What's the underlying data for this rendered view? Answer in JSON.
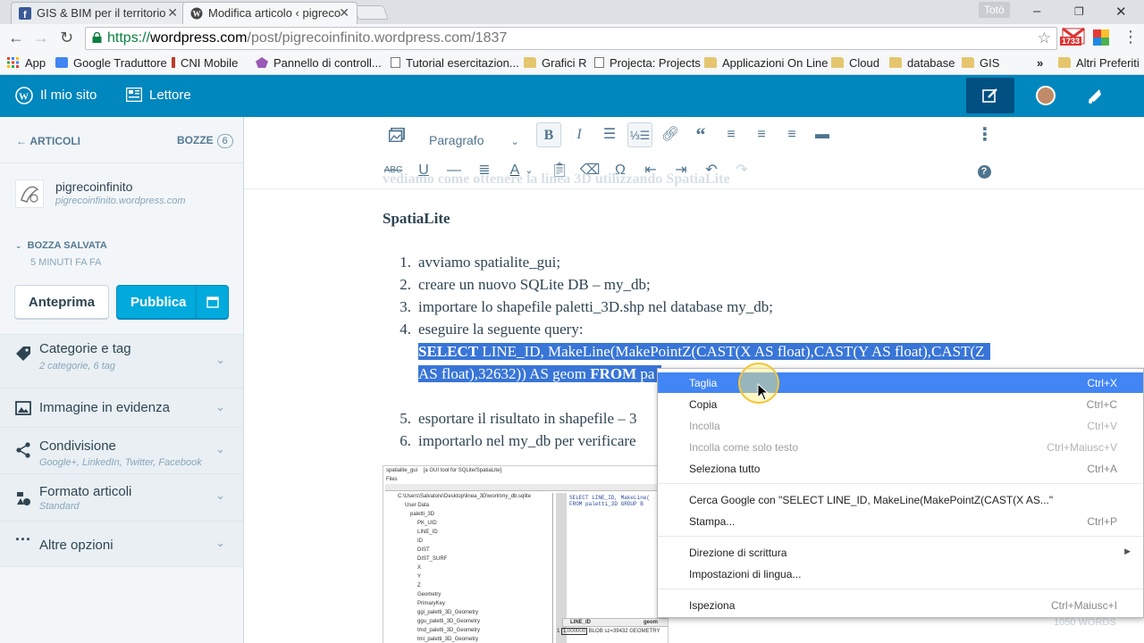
{
  "browser": {
    "tabs": [
      {
        "title": "GIS & BIM per il territorio"
      },
      {
        "title": "Modifica articolo ‹ pigreco"
      }
    ],
    "profile_name": "Totò",
    "url": {
      "scheme": "https://",
      "host": "wordpress.com",
      "path": "/post/pigrecoinfinito.wordpress.com/1837"
    },
    "ext_badge": "1733",
    "bookmarks": [
      "App",
      "Google Traduttore",
      "CNI Mobile",
      "Pannello di controll...",
      "Tutorial esercitazion...",
      "Grafici R",
      "Projecta: Projects",
      "Applicazioni On Line",
      "Cloud",
      "database",
      "GIS"
    ],
    "bookmarks_overflow": "»",
    "other_bookmarks": "Altri Preferiti"
  },
  "masterbar": {
    "my_site": "Il mio sito",
    "reader": "Lettore"
  },
  "sidebar": {
    "back_label": "ARTICOLI",
    "drafts_label": "BOZZE",
    "drafts_count": "6",
    "site_name": "pigrecoinfinito",
    "site_url": "pigrecoinfinito.wordpress.com",
    "status": "BOZZA SALVATA",
    "status_time": "5 MINUTI FA FA",
    "preview_label": "Anteprima",
    "publish_label": "Pubblica",
    "sections": [
      {
        "title": "Categorie e tag",
        "subtitle": "2 categorie, 6 tag",
        "icon": "tag-icon"
      },
      {
        "title": "Immagine in evidenza",
        "subtitle": "",
        "icon": "image-icon"
      },
      {
        "title": "Condivisione",
        "subtitle": "Google+, LinkedIn, Twitter, Facebook",
        "icon": "share-icon"
      },
      {
        "title": "Formato articoli",
        "subtitle": "Standard",
        "icon": "format-icon"
      },
      {
        "title": "Altre opzioni",
        "subtitle": "",
        "icon": "ellipsis-icon"
      }
    ]
  },
  "editor": {
    "paragraph_format": "Paragrafo",
    "ghost_text": "vediamo come ottenere la linea 3D utilizzando SpatiaLite",
    "heading": "SpatiaLite",
    "steps": [
      {
        "n": "1.",
        "text": "avviamo spatialite_gui;"
      },
      {
        "n": "2.",
        "text": "creare un nuovo SQLite DB – my_db;"
      },
      {
        "n": "3.",
        "text": "importare lo shapefile paletti_3D.shp nel database my_db;"
      },
      {
        "n": "4.",
        "text": "eseguire la seguente query:"
      }
    ],
    "query_line1_kw": "SELECT",
    "query_line1": " LINE_ID, MakeLine(MakePointZ(CAST(X AS float),CAST(Y AS float),CAST(Z",
    "query_line2_a": "AS float),32632)) AS geom ",
    "query_line2_kw": "FROM",
    "query_line2_b": " pa",
    "steps_after": [
      {
        "n": "5.",
        "text": "esportare il risultato in shapefile – 3"
      },
      {
        "n": "6.",
        "text": "importarlo nel my_db per verificare"
      }
    ],
    "word_count": "1050 WORDS",
    "embedded": {
      "title": "spatialite_gui",
      "subtitle": "[a GUI tool for SQLite/SpatiaLite]",
      "menu": "Files",
      "path": "C:\\Users\\Salvatore\\Desktop\\linea_3D\\work\\my_db.sqlite",
      "tree": [
        "User Data",
        "paletti_3D",
        "PK_UID",
        "LINE_ID",
        "ID",
        "DIST",
        "DIST_SURF",
        "X",
        "Y",
        "Z",
        "Geometry",
        "PrimaryKey",
        "ggi_paletti_3D_Geometry",
        "ggu_paletti_3D_Geometry",
        "tmd_paletti_3D_Geometry",
        "tmi_paletti_3D_Geometry"
      ],
      "sql_line1": "SELECT LINE_ID, MakeLine(",
      "sql_line2": "FROM paletti_3D GROUP B",
      "col1": "LINE_ID",
      "col2": "geom",
      "row_num": "1",
      "row_id": "1.000000",
      "row_blob": "BLOB sz=39432 GEOMETRY"
    }
  },
  "context_menu": {
    "items": [
      {
        "label": "Taglia",
        "shortcut": "Ctrl+X",
        "state": "highlighted"
      },
      {
        "label": "Copia",
        "shortcut": "Ctrl+C",
        "state": "normal"
      },
      {
        "label": "Incolla",
        "shortcut": "Ctrl+V",
        "state": "disabled"
      },
      {
        "label": "Incolla come solo testo",
        "shortcut": "Ctrl+Maiusc+V",
        "state": "disabled"
      },
      {
        "label": "Seleziona tutto",
        "shortcut": "Ctrl+A",
        "state": "normal"
      },
      {
        "label": "Cerca Google con \"SELECT LINE_ID, MakeLine(MakePointZ(CAST(X AS...\"",
        "shortcut": "",
        "state": "normal"
      },
      {
        "label": "Stampa...",
        "shortcut": "Ctrl+P",
        "state": "normal"
      },
      {
        "label": "Direzione di scrittura",
        "shortcut": "",
        "state": "submenu"
      },
      {
        "label": "Impostazioni di lingua...",
        "shortcut": "",
        "state": "normal"
      },
      {
        "label": "Ispeziona",
        "shortcut": "Ctrl+Maiusc+I",
        "state": "normal"
      }
    ]
  },
  "colors": {
    "masterbar": "#0087be",
    "publish": "#00aadc",
    "menu_highlight": "#4285f4",
    "selection": "#3875d7"
  }
}
